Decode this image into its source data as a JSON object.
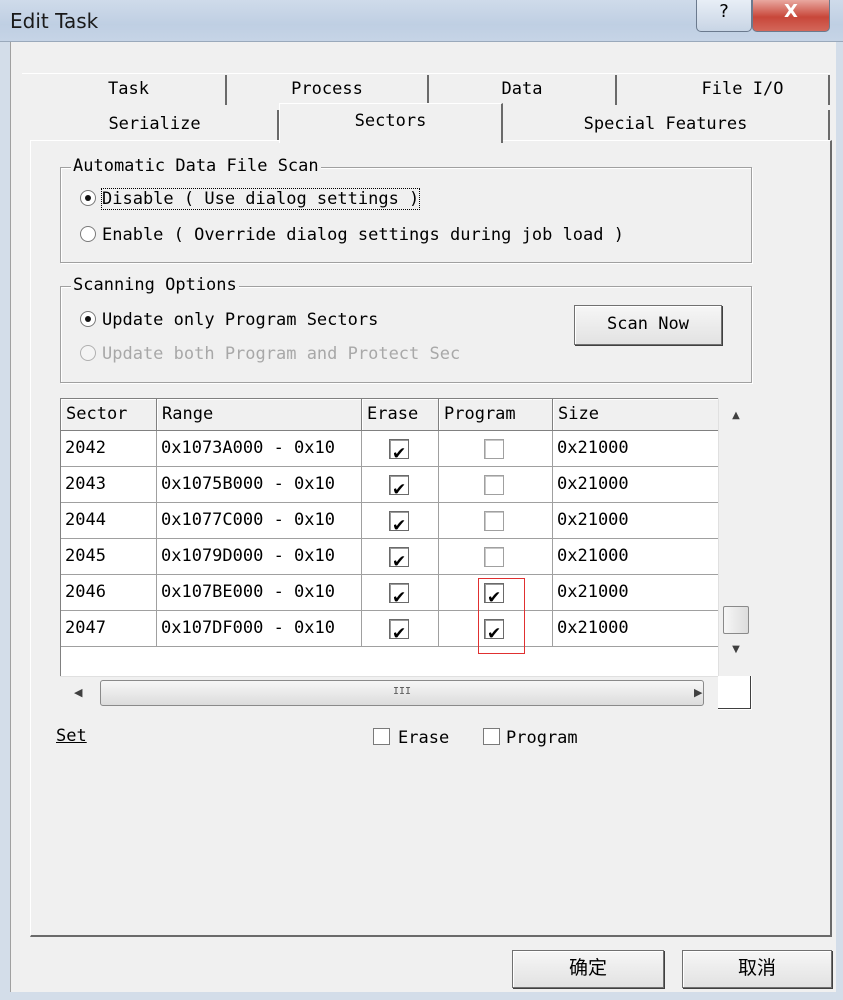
{
  "window": {
    "title": "Edit Task",
    "help_glyph": "?",
    "close_glyph": "X"
  },
  "tabs": {
    "row1": [
      "Task",
      "Process",
      "Data",
      "File I/O"
    ],
    "row2": [
      "Serialize",
      "Sectors",
      "Special Features"
    ],
    "active": "Sectors"
  },
  "auto_scan": {
    "legend": "Automatic Data File Scan",
    "option_disable": "Disable ( Use dialog settings )",
    "option_enable": "Enable ( Override dialog settings during job load )",
    "selected": "disable"
  },
  "scanning": {
    "legend": "Scanning Options",
    "option_program": "Update only Program Sectors",
    "option_both": "Update both Program and Protect Sec",
    "scan_now": "Scan Now"
  },
  "sector_table": {
    "headers": [
      "Sector",
      "Range",
      "Erase",
      "Program",
      "Size"
    ],
    "rows": [
      {
        "sector": "2042",
        "range": "0x1073A000 - 0x10",
        "erase": true,
        "program": false,
        "size": "0x21000"
      },
      {
        "sector": "2043",
        "range": "0x1075B000 - 0x10",
        "erase": true,
        "program": false,
        "size": "0x21000"
      },
      {
        "sector": "2044",
        "range": "0x1077C000 - 0x10",
        "erase": true,
        "program": false,
        "size": "0x21000"
      },
      {
        "sector": "2045",
        "range": "0x1079D000 - 0x10",
        "erase": true,
        "program": false,
        "size": "0x21000"
      },
      {
        "sector": "2046",
        "range": "0x107BE000 - 0x10",
        "erase": true,
        "program": true,
        "size": "0x21000"
      },
      {
        "sector": "2047",
        "range": "0x107DF000 - 0x10",
        "erase": true,
        "program": true,
        "size": "0x21000"
      }
    ],
    "hscroll_grip": "III"
  },
  "set_row": {
    "label": "Set",
    "erase_label": "Erase",
    "program_label": "Program"
  },
  "footer": {
    "ok": "确定",
    "cancel": "取消"
  },
  "colors": {
    "highlight_box": "#e03030",
    "close_button": "#c8473a"
  }
}
